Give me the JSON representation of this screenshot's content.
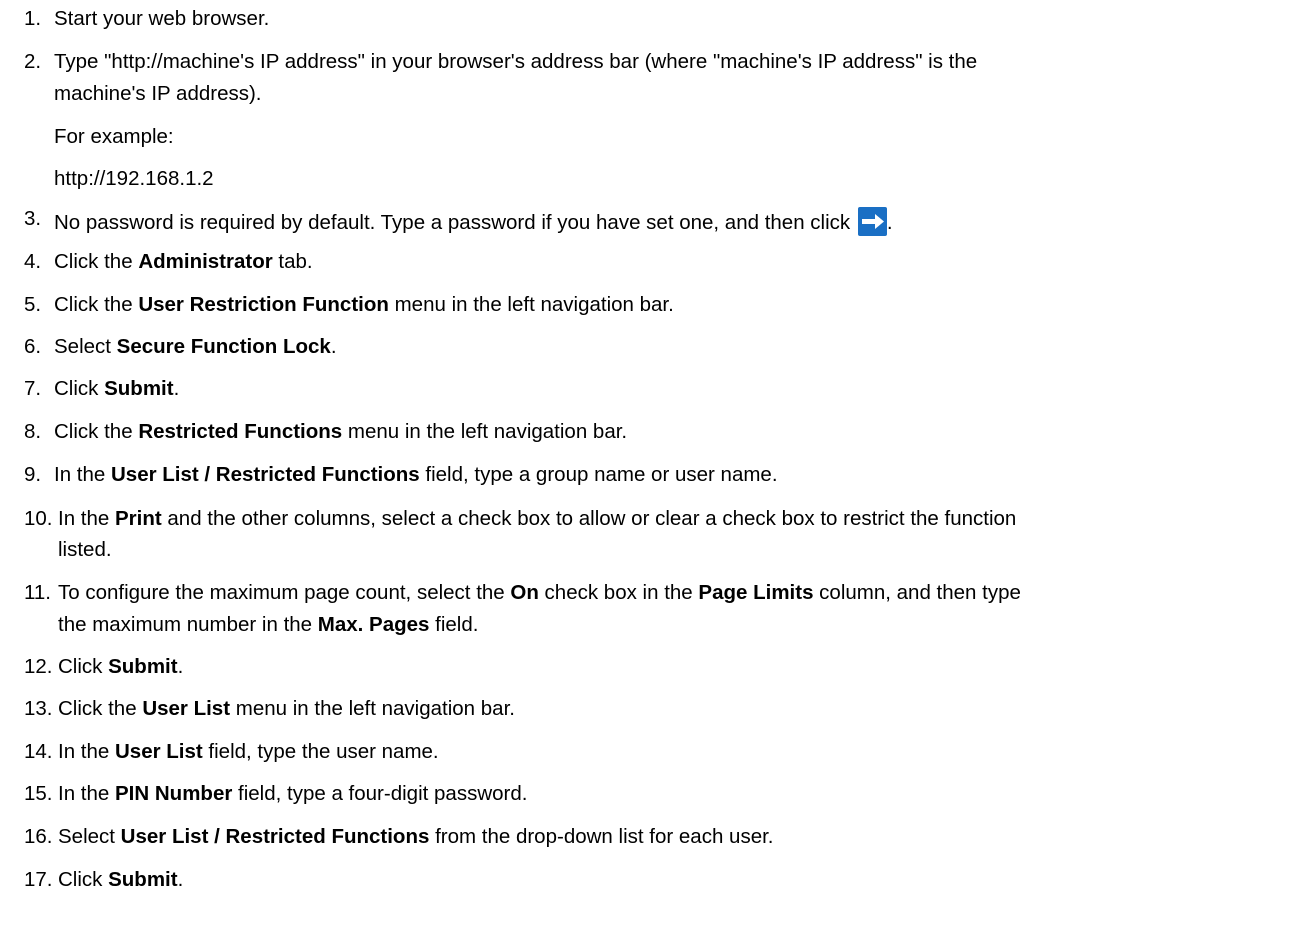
{
  "steps": [
    {
      "num": "1.",
      "parts": [
        {
          "t": "Start your web browser."
        }
      ]
    },
    {
      "num": "2.",
      "parts": [
        {
          "t": "Type \"http://machine's IP address\" in your browser's address bar (where \"machine's IP address\" is the"
        }
      ],
      "cont": "machine's IP address).",
      "extra": [
        "For example:",
        "http://192.168.1.2"
      ]
    },
    {
      "num": "3.",
      "parts": [
        {
          "t": "No password is required by default. Type a password if you have set one, and then click "
        }
      ],
      "icon": "arrow-right-icon",
      "after_icon": "."
    },
    {
      "num": "4.",
      "parts": [
        {
          "t": "Click the "
        },
        {
          "b": "Administrator"
        },
        {
          "t": " tab."
        }
      ]
    },
    {
      "num": "5.",
      "parts": [
        {
          "t": "Click the "
        },
        {
          "b": "User Restriction Function"
        },
        {
          "t": " menu in the left navigation bar."
        }
      ]
    },
    {
      "num": "6.",
      "parts": [
        {
          "t": "Select "
        },
        {
          "b": "Secure Function Lock"
        },
        {
          "t": "."
        }
      ]
    },
    {
      "num": "7.",
      "parts": [
        {
          "t": "Click "
        },
        {
          "b": "Submit"
        },
        {
          "t": "."
        }
      ]
    },
    {
      "num": "8.",
      "parts": [
        {
          "t": "Click the "
        },
        {
          "b": "Restricted Functions"
        },
        {
          "t": " menu in the left navigation bar."
        }
      ]
    },
    {
      "num": "9.",
      "parts": [
        {
          "t": "In the "
        },
        {
          "b": "User List / Restricted Functions"
        },
        {
          "t": " field, type a group name or user name."
        }
      ]
    },
    {
      "num": "10.",
      "parts": [
        {
          "t": "In the "
        },
        {
          "b": "Print"
        },
        {
          "t": " and the other columns, select a check box to allow or clear a check box to restrict the function"
        }
      ],
      "cont": "listed."
    },
    {
      "num": "11.",
      "parts": [
        {
          "t": "To configure the maximum page count, select the "
        },
        {
          "b": "On"
        },
        {
          "t": " check box in the "
        },
        {
          "b": "Page Limits"
        },
        {
          "t": " column, and then type"
        }
      ],
      "cont_parts": [
        {
          "t": "the maximum number in the "
        },
        {
          "b": "Max. Pages"
        },
        {
          "t": " field."
        }
      ]
    },
    {
      "num": "12.",
      "parts": [
        {
          "t": "Click "
        },
        {
          "b": "Submit"
        },
        {
          "t": "."
        }
      ]
    },
    {
      "num": "13.",
      "parts": [
        {
          "t": "Click the "
        },
        {
          "b": "User List"
        },
        {
          "t": " menu in the left navigation bar."
        }
      ]
    },
    {
      "num": "14.",
      "parts": [
        {
          "t": "In the "
        },
        {
          "b": "User List"
        },
        {
          "t": " field, type the user name."
        }
      ]
    },
    {
      "num": "15.",
      "parts": [
        {
          "t": "In the "
        },
        {
          "b": "PIN Number"
        },
        {
          "t": " field, type a four-digit password."
        }
      ]
    },
    {
      "num": "16.",
      "parts": [
        {
          "t": "Select "
        },
        {
          "b": "User List / Restricted Functions"
        },
        {
          "t": " from the drop-down list for each user."
        }
      ]
    },
    {
      "num": "17.",
      "parts": [
        {
          "t": "Click "
        },
        {
          "b": "Submit"
        },
        {
          "t": "."
        }
      ]
    }
  ],
  "colors": {
    "text": "#000000",
    "icon_bg": "#1a6fc4",
    "icon_arrow": "#ffffff"
  }
}
